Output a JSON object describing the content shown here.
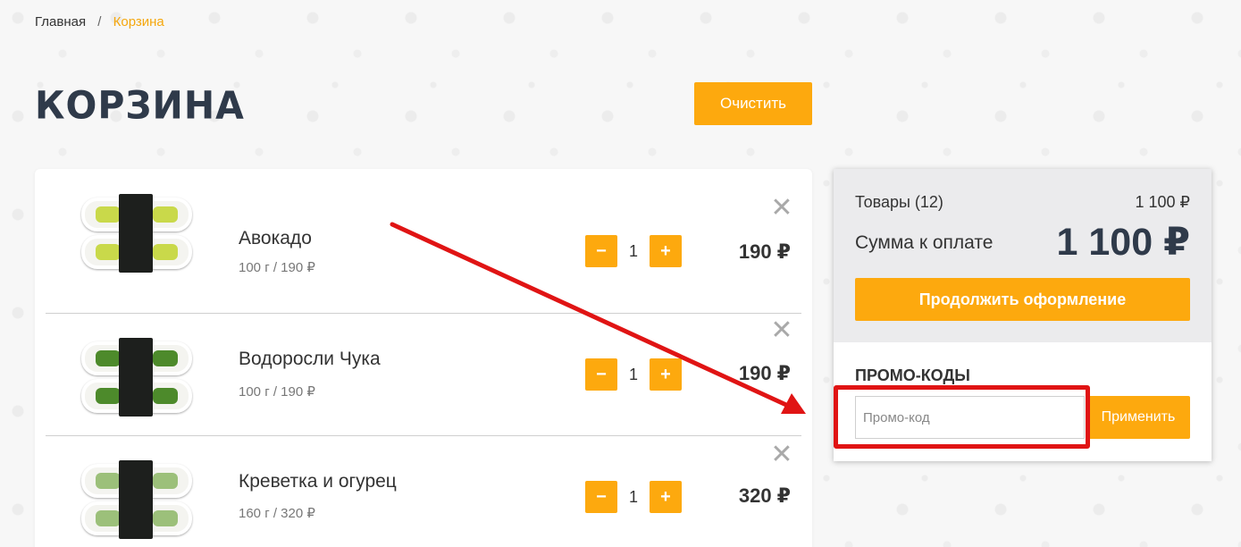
{
  "breadcrumb": {
    "home": "Главная",
    "separator": "/",
    "current": "Корзина"
  },
  "page": {
    "title": "Корзина",
    "clear_label": "Очистить"
  },
  "cart": {
    "items": [
      {
        "name": "Авокадо",
        "sub": "100 г / 190 ₽",
        "qty": "1",
        "price": "190 ₽",
        "filling": "#c9d94a",
        "minus": "−",
        "plus": "+",
        "remove": "✕"
      },
      {
        "name": "Водоросли Чука",
        "sub": "100 г / 190 ₽",
        "qty": "1",
        "price": "190 ₽",
        "filling": "#4d8a2b",
        "minus": "−",
        "plus": "+",
        "remove": "✕"
      },
      {
        "name": "Креветка и огурец",
        "sub": "160 г / 320 ₽",
        "qty": "1",
        "price": "320 ₽",
        "filling": "#9cc07a",
        "minus": "−",
        "plus": "+",
        "remove": "✕"
      }
    ]
  },
  "summary": {
    "goods_label": "Товары (12)",
    "goods_amount": "1 100 ₽",
    "total_label": "Сумма к оплате",
    "total_amount": "1 100 ₽",
    "checkout_label": "Продолжить оформление",
    "promo_title": "ПРОМО-КОДЫ",
    "promo_placeholder": "Промо-код",
    "apply_label": "Применить"
  },
  "colors": {
    "accent": "#fda90e",
    "annotation": "#e01414",
    "heading": "#2f3a4a"
  }
}
